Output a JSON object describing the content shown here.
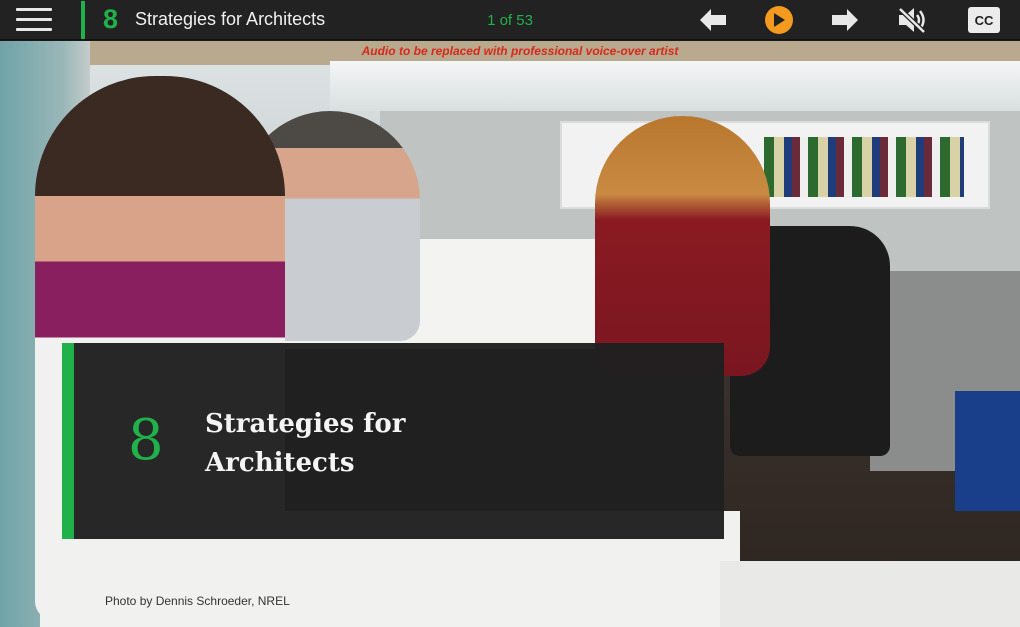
{
  "toolbar": {
    "lesson_number": "8",
    "lesson_title": "Strategies for Architects",
    "page_counter": "1 of 53",
    "cc_label": "CC",
    "icons": {
      "menu": "hamburger-menu-icon",
      "previous": "arrow-left-icon",
      "play": "play-icon",
      "next": "arrow-right-icon",
      "mute": "speaker-muted-icon",
      "captions": "closed-captions-icon"
    },
    "colors": {
      "accent": "#21b14b",
      "play": "#f29b1e",
      "bar": "#222222"
    }
  },
  "slide": {
    "audio_note": "Audio to be replaced with professional voice-over artist",
    "card_number": "8",
    "card_title": "Strategies for Architects",
    "photo_credit": "Photo by Dennis Schroeder, NREL"
  }
}
